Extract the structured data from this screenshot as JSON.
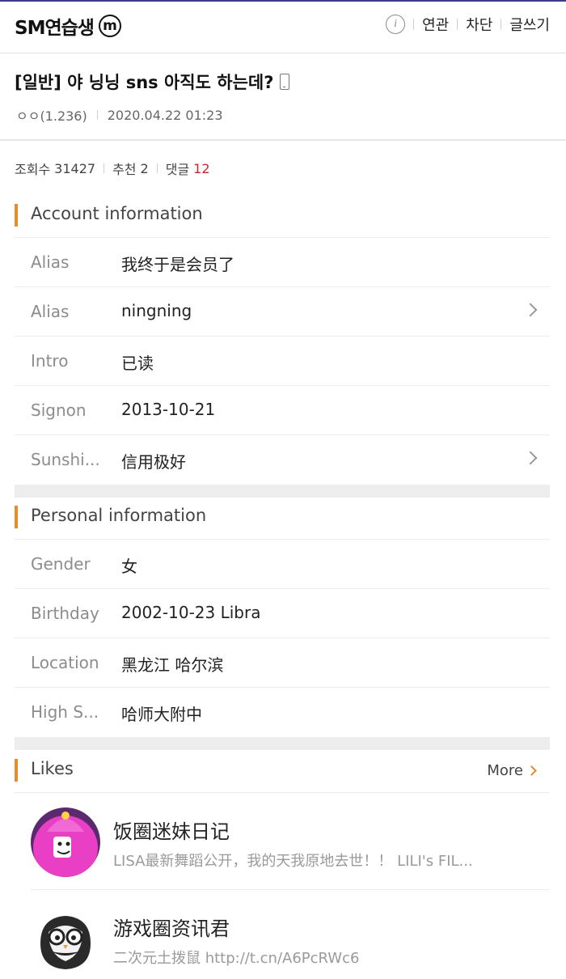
{
  "header": {
    "brand": "SM연습생",
    "brand_badge": "m",
    "info_icon": "info-icon",
    "links": [
      "연관",
      "차단",
      "글쓰기"
    ]
  },
  "post": {
    "title": "[일반] 야 닝닝 sns 아직도 하는데?",
    "author": "ㅇㅇ(1.236)",
    "datetime": "2020.04.22 01:23"
  },
  "stats": {
    "views_label": "조회수",
    "views": "31427",
    "recommend_label": "추천",
    "recommend": "2",
    "comments_label": "댓글",
    "comments": "12"
  },
  "account": {
    "title": "Account information",
    "rows": [
      {
        "label": "Alias",
        "value": "我终于是会员了"
      },
      {
        "label": "Alias",
        "value": "ningning"
      },
      {
        "label": "Intro",
        "value": "已读"
      },
      {
        "label": "Signon",
        "value": "2013-10-21"
      },
      {
        "label": "Sunshi...",
        "value": "信用极好"
      }
    ]
  },
  "personal": {
    "title": "Personal information",
    "rows": [
      {
        "label": "Gender",
        "value": "女"
      },
      {
        "label": "Birthday",
        "value": "2002-10-23  Libra"
      },
      {
        "label": "Location",
        "value": "黑龙江 哈尔滨"
      },
      {
        "label": "High S...",
        "value": "哈师大附中"
      }
    ]
  },
  "likes": {
    "title": "Likes",
    "more": "More",
    "items": [
      {
        "name": "饭圈迷妹日记",
        "desc": "LISA最新舞蹈公开，我的天我原地去世！！ LILI's FIL..."
      },
      {
        "name": "游戏圈资讯君",
        "desc": "二次元土拨鼠  http://t.cn/A6PcRWc6"
      }
    ]
  },
  "colors": {
    "accent": "#e88a2e",
    "comment_count": "#c62828",
    "top_border": "#3b3b8f"
  }
}
